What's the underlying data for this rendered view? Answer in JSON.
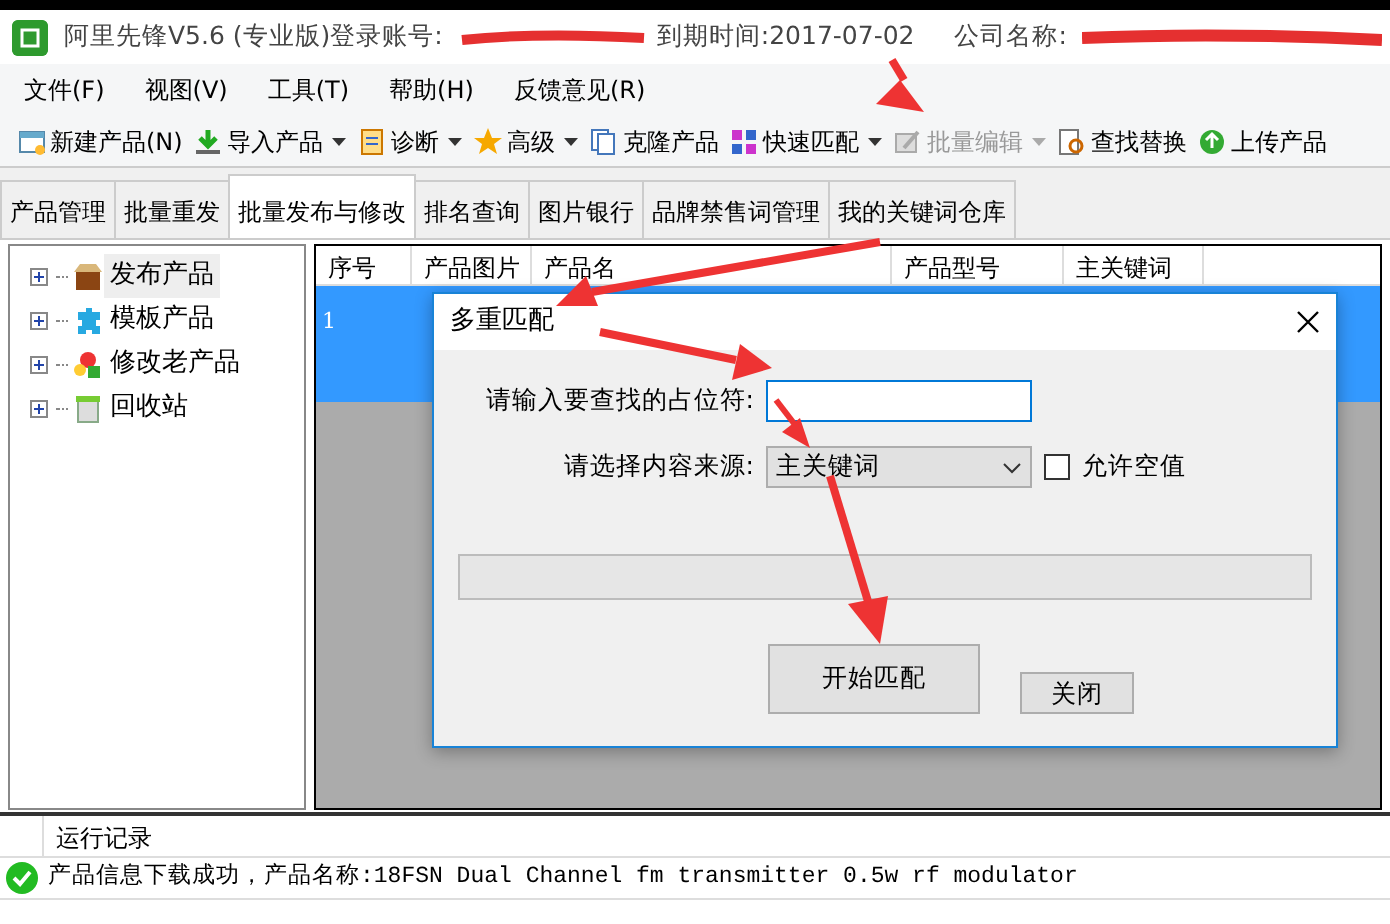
{
  "window": {
    "title": "阿里先锋V5.6 (专业版)登录账号:",
    "expiry": "到期时间:2017-07-02",
    "company": "公司名称:"
  },
  "menu": [
    "文件(F)",
    "视图(V)",
    "工具(T)",
    "帮助(H)",
    "反馈意见(R)"
  ],
  "toolbar": [
    {
      "label": "新建产品(N)",
      "dropdown": false,
      "disabled": false
    },
    {
      "label": "导入产品",
      "dropdown": true,
      "disabled": false
    },
    {
      "label": "诊断",
      "dropdown": true,
      "disabled": false
    },
    {
      "label": "高级",
      "dropdown": true,
      "disabled": false
    },
    {
      "label": "克隆产品",
      "dropdown": false,
      "disabled": false
    },
    {
      "label": "快速匹配",
      "dropdown": true,
      "disabled": false
    },
    {
      "label": "批量编辑",
      "dropdown": true,
      "disabled": true
    },
    {
      "label": "查找替换",
      "dropdown": false,
      "disabled": false
    },
    {
      "label": "上传产品",
      "dropdown": false,
      "disabled": false
    }
  ],
  "tabs": [
    {
      "label": "产品管理",
      "selected": false
    },
    {
      "label": "批量重发",
      "selected": false
    },
    {
      "label": "批量发布与修改",
      "selected": true
    },
    {
      "label": "排名查询",
      "selected": false
    },
    {
      "label": "图片银行",
      "selected": false
    },
    {
      "label": "品牌禁售词管理",
      "selected": false
    },
    {
      "label": "我的关键词仓库",
      "selected": false
    }
  ],
  "tree": [
    {
      "label": "发布产品",
      "selected": true
    },
    {
      "label": "模板产品",
      "selected": false
    },
    {
      "label": "修改老产品",
      "selected": false
    },
    {
      "label": "回收站",
      "selected": false
    }
  ],
  "table": {
    "columns": [
      "序号",
      "产品图片",
      "产品名",
      "产品型号",
      "主关键词"
    ],
    "rows": [
      {
        "cells": [
          "1"
        ],
        "selected": true
      }
    ]
  },
  "dialog": {
    "title": "多重匹配",
    "placeholder_label": "请输入要查找的占位符:",
    "source_label": "请选择内容来源:",
    "source_value": "主关键词",
    "allow_empty": {
      "label": "允许空值",
      "checked": false
    },
    "progress": {
      "level": 0
    },
    "buttons": [
      "开始匹配",
      "关闭"
    ]
  },
  "log": {
    "header": "运行记录",
    "entries": [
      {
        "kind": "success",
        "text": "产品信息下载成功，产品名称:18FSN Dual Channel fm transmitter 0.5w rf modulator"
      }
    ]
  }
}
